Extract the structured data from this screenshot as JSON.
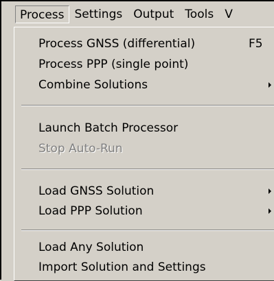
{
  "menubar": {
    "items": [
      "Process",
      "Settings",
      "Output",
      "Tools",
      "V"
    ]
  },
  "process_menu": {
    "items": [
      {
        "label": "Process GNSS (differential)",
        "shortcut": "F5"
      },
      {
        "label": "Process PPP (single point)"
      },
      {
        "label": "Combine Solutions",
        "submenu": true
      },
      {
        "label": "Launch Batch Processor"
      },
      {
        "label": "Stop Auto-Run",
        "disabled": true
      },
      {
        "label": "Load GNSS Solution",
        "submenu": true
      },
      {
        "label": "Load PPP Solution",
        "submenu": true
      },
      {
        "label": "Load Any Solution"
      },
      {
        "label": "Import Solution and Settings"
      }
    ]
  }
}
